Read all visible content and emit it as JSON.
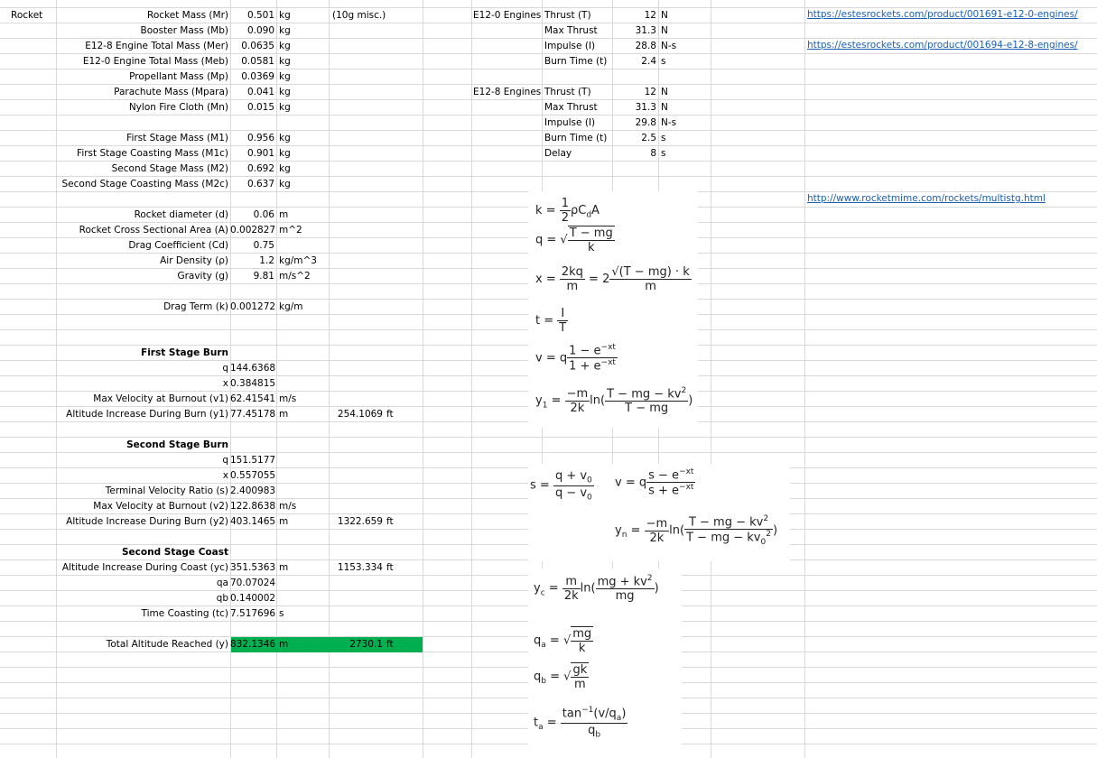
{
  "sheet": {
    "a1": "Rocket",
    "params": [
      {
        "label": "Rocket Mass (Mr)",
        "value": "0.501",
        "unit": "kg",
        "note": "(10g misc.)"
      },
      {
        "label": "Booster Mass (Mb)",
        "value": "0.090",
        "unit": "kg"
      },
      {
        "label": "E12-8 Engine Total Mass (Mer)",
        "value": "0.0635",
        "unit": "kg"
      },
      {
        "label": "E12-0 Engine Total Mass (Meb)",
        "value": "0.0581",
        "unit": "kg"
      },
      {
        "label": "Propellant Mass (Mp)",
        "value": "0.0369",
        "unit": "kg"
      },
      {
        "label": "Parachute Mass (Mpara)",
        "value": "0.041",
        "unit": "kg"
      },
      {
        "label": "Nylon Fire Cloth (Mn)",
        "value": "0.015",
        "unit": "kg"
      },
      {
        "label": "First Stage Mass (M1)",
        "value": "0.956",
        "unit": "kg"
      },
      {
        "label": "First Stage Coasting Mass (M1c)",
        "value": "0.901",
        "unit": "kg"
      },
      {
        "label": "Second Stage Mass (M2)",
        "value": "0.692",
        "unit": "kg"
      },
      {
        "label": "Second Stage Coasting Mass (M2c)",
        "value": "0.637",
        "unit": "kg"
      },
      {
        "label": "Rocket diameter (d)",
        "value": "0.06",
        "unit": "m"
      },
      {
        "label": "Rocket Cross Sectional Area (A)",
        "value": "0.002827",
        "unit": "m^2"
      },
      {
        "label": "Drag Coefficient (Cd)",
        "value": "0.75",
        "unit": ""
      },
      {
        "label": "Air Density (ρ)",
        "value": "1.2",
        "unit": "kg/m^3"
      },
      {
        "label": "Gravity (g)",
        "value": "9.81",
        "unit": "m/s^2"
      },
      {
        "label": "Drag Term (k)",
        "value": "0.001272",
        "unit": "kg/m"
      }
    ],
    "first_burn": {
      "heading": "First Stage Burn",
      "rows": [
        {
          "label": "q",
          "value": "144.6368",
          "unit": ""
        },
        {
          "label": "x",
          "value": "0.384815",
          "unit": ""
        },
        {
          "label": "Max Velocity at Burnout (v1)",
          "value": "62.41541",
          "unit": "m/s"
        },
        {
          "label": "Altitude Increase During Burn (y1)",
          "value": "77.45178",
          "unit": "m",
          "ft": "254.1069",
          "ftunit": "ft"
        }
      ]
    },
    "second_burn": {
      "heading": "Second Stage Burn",
      "rows": [
        {
          "label": "q",
          "value": "151.5177",
          "unit": ""
        },
        {
          "label": "x",
          "value": "0.557055",
          "unit": ""
        },
        {
          "label": "Terminal Velocity Ratio (s)",
          "value": "2.400983",
          "unit": ""
        },
        {
          "label": "Max Velocity at Burnout (v2)",
          "value": "122.8638",
          "unit": "m/s"
        },
        {
          "label": "Altitude Increase During Burn (y2)",
          "value": "403.1465",
          "unit": "m",
          "ft": "1322.659",
          "ftunit": "ft"
        }
      ]
    },
    "second_coast": {
      "heading": "Second Stage Coast",
      "rows": [
        {
          "label": "Altitude Increase During Coast (yc)",
          "value": "351.5363",
          "unit": "m",
          "ft": "1153.334",
          "ftunit": "ft"
        },
        {
          "label": "qa",
          "value": "70.07024",
          "unit": ""
        },
        {
          "label": "qb",
          "value": "0.140002",
          "unit": ""
        },
        {
          "label": "Time Coasting (tc)",
          "value": "7.517696",
          "unit": "s"
        }
      ]
    },
    "total": {
      "label": "Total Altitude Reached (y)",
      "value": "832.1346",
      "unit": "m",
      "ft": "2730.1",
      "ftunit": "ft",
      "highlight": "#00b050"
    },
    "e12_0": {
      "title": "E12-0 Engines",
      "rows": [
        {
          "label": "Thrust (T)",
          "value": "12",
          "unit": "N"
        },
        {
          "label": "Max Thrust",
          "value": "31.3",
          "unit": "N"
        },
        {
          "label": "Impulse (I)",
          "value": "28.8",
          "unit": "N-s"
        },
        {
          "label": "Burn Time (t)",
          "value": "2.4",
          "unit": "s"
        }
      ]
    },
    "e12_8": {
      "title": "E12-8 Engines",
      "rows": [
        {
          "label": "Thrust (T)",
          "value": "12",
          "unit": "N"
        },
        {
          "label": "Max Thrust",
          "value": "31.3",
          "unit": "N"
        },
        {
          "label": "Impulse (I)",
          "value": "29.8",
          "unit": "N-s"
        },
        {
          "label": "Burn Time (t)",
          "value": "2.5",
          "unit": "s"
        },
        {
          "label": "Delay",
          "value": "8",
          "unit": "s"
        }
      ]
    },
    "links": [
      "https://estesrockets.com/product/001691-e12-0-engines/",
      "https://estesrockets.com/product/001694-e12-8-engines/",
      "http://www.rocketmime.com/rockets/multistg.html"
    ]
  }
}
